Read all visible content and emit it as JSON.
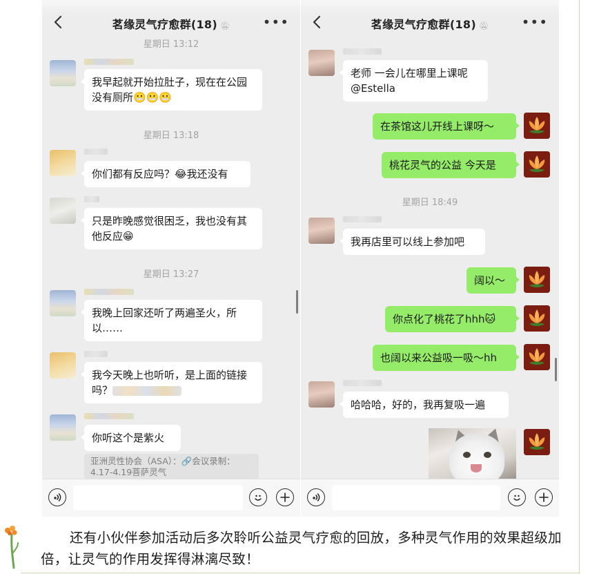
{
  "left_chat": {
    "title": "茗缘灵气疗愈群(18)",
    "mute_icon": "bell-off-icon",
    "more_label": "•••",
    "timestamps": [
      "星期日 13:12",
      "星期日 13:18",
      "星期日 13:27"
    ],
    "messages": [
      "我早起就开始拉肚子，现在在公园没有厕所😬😬😬",
      "你们都有反应吗？😂我还没有",
      "只是昨晚感觉很困乏，我也没有其他反应😁",
      "我晚上回家还听了两遍圣火，所以……",
      "我今天晚上也听听，是上面的链接吗？",
      "你听这个是紫火"
    ],
    "quote": "亚洲灵性协会（ASA）：🔗会议录制：4.17-4.19菩萨灵气"
  },
  "right_chat": {
    "title": "茗缘灵气疗愈群(18)",
    "mute_icon": "bell-off-icon",
    "more_label": "•••",
    "timestamps": [
      "星期日 18:49"
    ],
    "messages_in": [
      "老师 一会儿在哪里上课呢@Estella",
      "我再店里可以线上参加吧",
      "哈哈哈，好的，我再复吸一遍"
    ],
    "messages_out": [
      "在茶馆这儿开线上课呀～",
      "桃花灵气的公益 今天是",
      "阔以～",
      "你点化了桃花了hhh🐱",
      "也阔以来公益吸一吸～hh"
    ]
  },
  "input_bar": {
    "voice_icon": "voice-icon",
    "emoji_icon": "emoji-icon",
    "plus_icon": "plus-icon"
  },
  "caption": "还有小伙伴参加活动后多次聆听公益灵气疗愈的回放，多种灵气作用的效果超级加倍，让灵气的作用发挥得淋漓尽致！",
  "colors": {
    "chat_bg": "#ededed",
    "outgoing_bubble": "#95ec69",
    "incoming_bubble": "#ffffff",
    "timestamp": "#a3a3a3"
  }
}
